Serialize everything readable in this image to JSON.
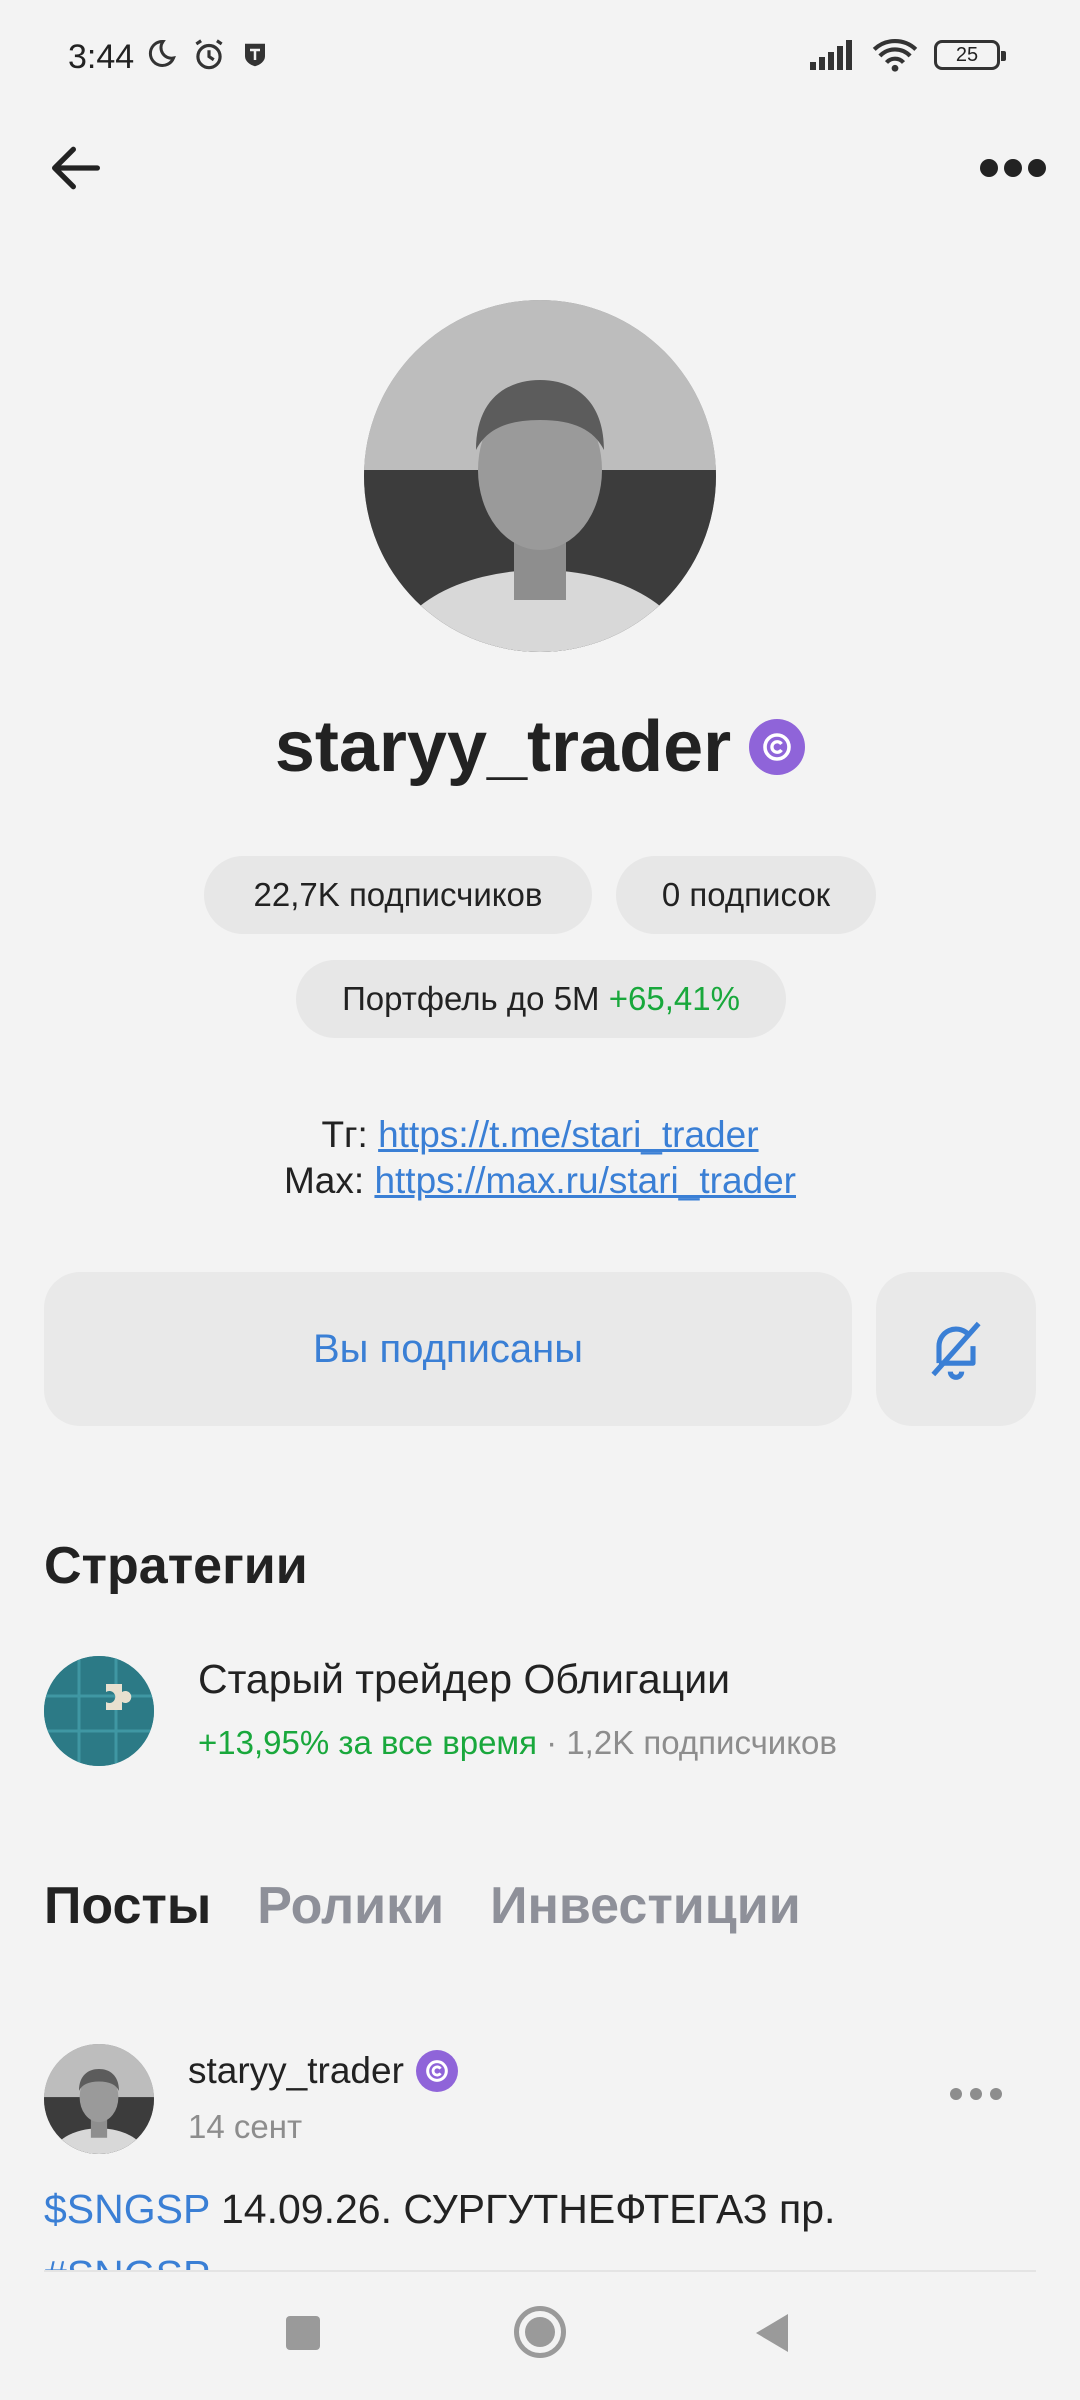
{
  "status_bar": {
    "time": "3:44",
    "battery": "25",
    "icons": [
      "moon-icon",
      "alarm-icon",
      "shield-app-icon",
      "signal-icon",
      "wifi-icon",
      "battery-icon"
    ]
  },
  "header": {
    "back_icon": "arrow-left-icon",
    "more_icon": "more-dots-icon"
  },
  "profile": {
    "username": "staryy_trader",
    "followers": "22,7K подписчиков",
    "following": "0 подписок",
    "portfolio_label": "Портфель до 5М",
    "portfolio_value": "+65,41%",
    "links": [
      {
        "prefix": "Тг:",
        "url": "https://t.me/stari_trader"
      },
      {
        "prefix": "Max:",
        "url": "https://max.ru/stari_trader"
      }
    ],
    "subscribed_label": "Вы подписаны",
    "bell_icon": "bell-off-icon"
  },
  "strategies": {
    "title": "Стратегии",
    "items": [
      {
        "name": "Старый трейдер Облигации",
        "return": "+13,95% за все время",
        "separator": " · ",
        "subscribers": "1,2K подписчиков"
      }
    ]
  },
  "tabs": [
    {
      "label": "Посты",
      "active": true
    },
    {
      "label": "Ролики",
      "active": false
    },
    {
      "label": "Инвестиции",
      "active": false
    }
  ],
  "post": {
    "author": "staryy_trader",
    "date": "14 сент",
    "ticker": "$SNGSP",
    "text": " 14.09.26. СУРГУТНЕФТЕГАЗ пр.",
    "hashtag": "#SNGSP"
  },
  "colors": {
    "accent_blue": "#3a7fd5",
    "green": "#19a83c",
    "badge_purple": "#8f64d9",
    "background": "#f3f3f3"
  }
}
